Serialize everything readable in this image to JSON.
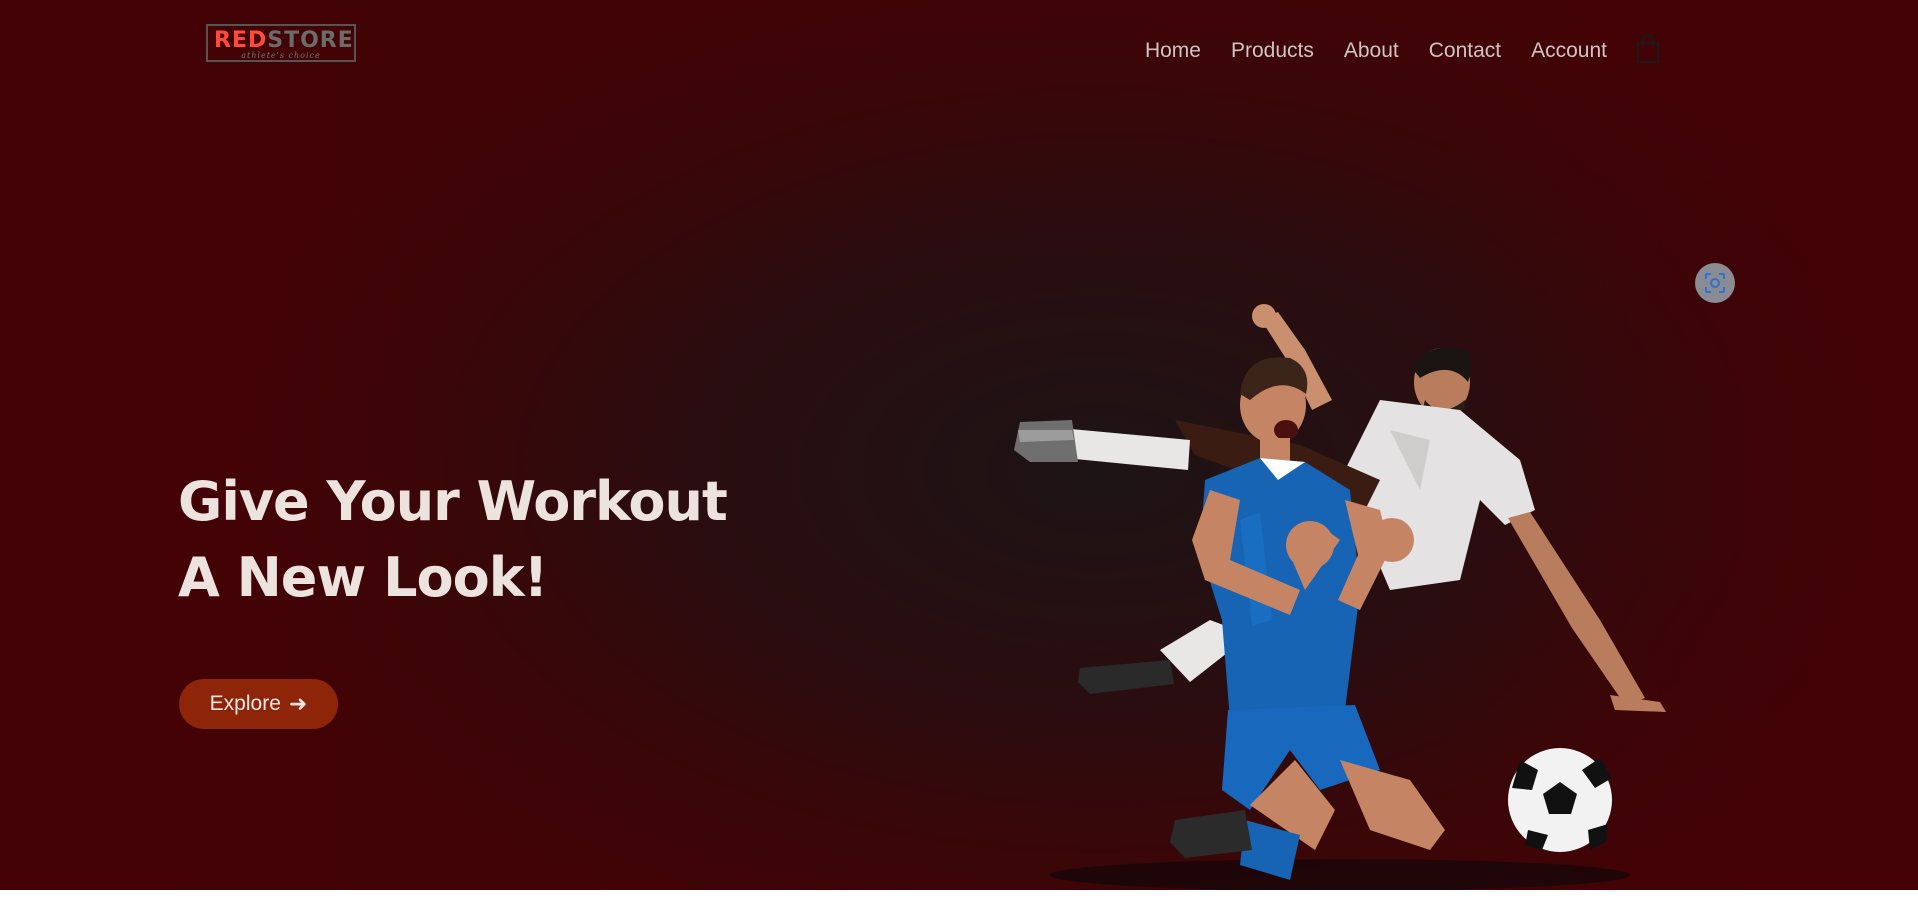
{
  "logo": {
    "red_part": "RED",
    "grey_part": "STORE",
    "tagline": "athlete's choice"
  },
  "nav": {
    "items": [
      {
        "label": "Home"
      },
      {
        "label": "Products"
      },
      {
        "label": "About"
      },
      {
        "label": "Contact"
      },
      {
        "label": "Account"
      }
    ],
    "cart_icon": "shopping-bag-icon"
  },
  "hero": {
    "headline_line1": "Give Your Workout",
    "headline_line2": "A New Look!",
    "cta_label": "Explore",
    "cta_arrow": "➜",
    "image_subject": "football-players-illustration"
  },
  "overlay": {
    "lens_icon": "visual-search-icon"
  },
  "colors": {
    "background": "#3a0608",
    "accent_red": "#ff4b3a",
    "cta_background": "#8e2509",
    "nav_text": "#cfc3c3",
    "headline_text": "#ede3de"
  }
}
